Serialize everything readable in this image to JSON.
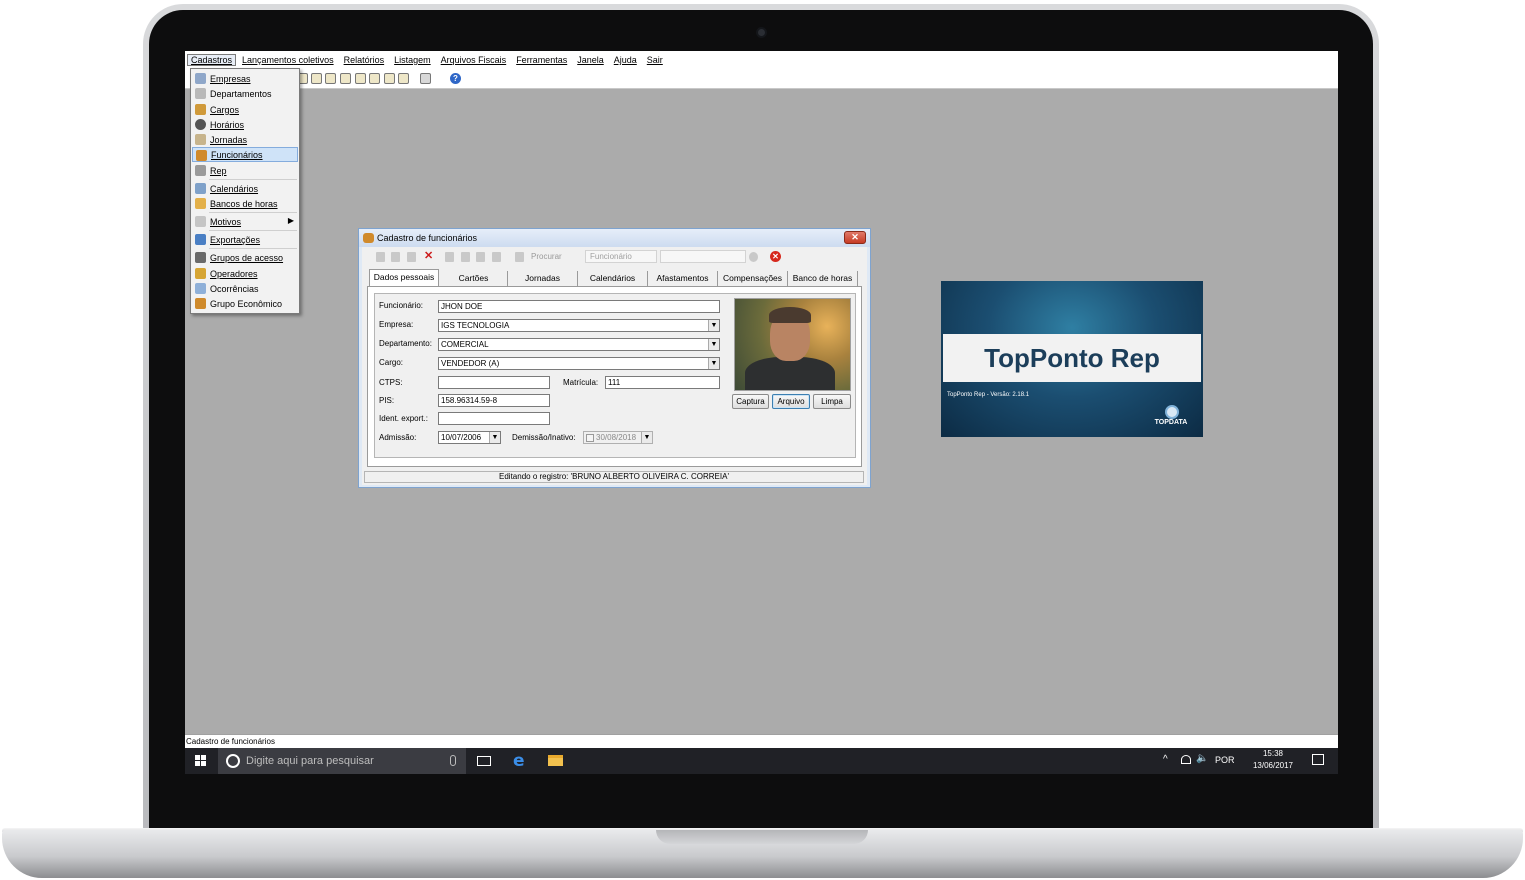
{
  "menubar": {
    "items": [
      "Cadastros",
      "Lançamentos coletivos",
      "Relatórios",
      "Listagem",
      "Arquivos Fiscais",
      "Ferramentas",
      "Janela",
      "Ajuda",
      "Sair"
    ]
  },
  "dropdown": {
    "items": [
      "Empresas",
      "Departamentos",
      "Cargos",
      "Horários",
      "Jornadas",
      "Funcionários",
      "Rep",
      "Calendários",
      "Bancos de horas",
      "Motivos",
      "Exportações",
      "Grupos de acesso",
      "Operadores",
      "Ocorrências",
      "Grupo Econômico"
    ]
  },
  "dialog": {
    "title": "Cadastro de funcionários",
    "toolbar": {
      "search_label": "Procurar",
      "combo_value": "Funcionário"
    },
    "tabs": [
      "Dados pessoais",
      "Cartões",
      "Jornadas",
      "Calendários",
      "Afastamentos",
      "Compensações",
      "Banco de horas"
    ],
    "form": {
      "funcionario_label": "Funcionário:",
      "funcionario_value": "JHON DOE",
      "empresa_label": "Empresa:",
      "empresa_value": "IGS TECNOLOGIA",
      "departamento_label": "Departamento:",
      "departamento_value": "COMERCIAL",
      "cargo_label": "Cargo:",
      "cargo_value": "VENDEDOR (A)",
      "ctps_label": "CTPS:",
      "ctps_value": "",
      "matricula_label": "Matrícula:",
      "matricula_value": "111",
      "pis_label": "PIS:",
      "pis_value": "158.96314.59-8",
      "ident_label": "Ident. export.:",
      "ident_value": "",
      "admissao_label": "Admissão:",
      "admissao_value": "10/07/2006",
      "demissao_label": "Demissão/Inativo:",
      "demissao_value": "30/08/2018"
    },
    "photo_buttons": {
      "captura": "Captura",
      "arquivo": "Arquivo",
      "limpa": "Limpa"
    },
    "status": "Editando o registro: 'BRUNO ALBERTO OLIVEIRA C. CORREIA'"
  },
  "splash": {
    "title": "TopPonto Rep",
    "version": "TopPonto Rep - Versão: 2.18.1",
    "logo_text": "TOPDATA"
  },
  "app_status": "Cadastro de funcionários",
  "taskbar": {
    "search_placeholder": "Digite aqui para pesquisar",
    "language": "POR",
    "time": "15:38",
    "date": "13/06/2017"
  },
  "colors": {
    "desktop_bg": "#ababab",
    "highlight": "#cfe3f8",
    "taskbar": "#202126",
    "splash_title": "#1c3e5a"
  },
  "icons": [
    "windows-start-icon",
    "search-icon",
    "microphone-icon",
    "task-view-icon",
    "edge-icon",
    "file-explorer-icon",
    "help-icon",
    "close-icon",
    "stop-icon",
    "notification-icon"
  ]
}
